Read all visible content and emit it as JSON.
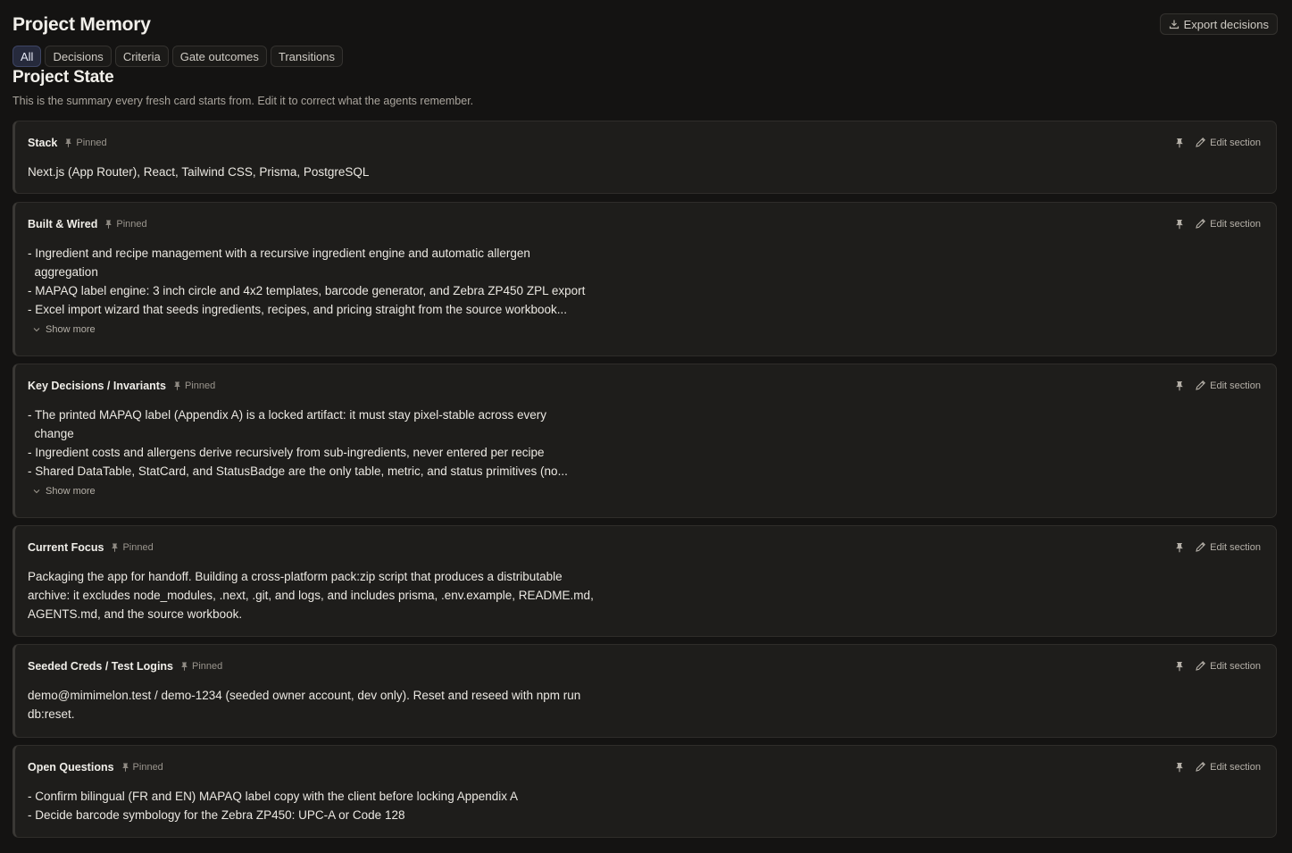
{
  "page": {
    "title": "Project Memory",
    "export_label": "Export decisions",
    "heading": "Project State",
    "subtitle": "This is the summary every fresh card starts from. Edit it to correct what the agents remember."
  },
  "tabs": [
    {
      "label": "All",
      "active": true
    },
    {
      "label": "Decisions"
    },
    {
      "label": "Criteria"
    },
    {
      "label": "Gate outcomes"
    },
    {
      "label": "Transitions"
    }
  ],
  "labels": {
    "pinned": "Pinned",
    "edit": "Edit section",
    "show_more": "Show more"
  },
  "sections": [
    {
      "title": "Stack",
      "lines": [
        "Next.js (App Router), React, Tailwind CSS, Prisma, PostgreSQL"
      ]
    },
    {
      "title": "Built & Wired",
      "lines": [
        "- Ingredient and recipe management with a recursive ingredient engine and automatic allergen",
        "  aggregation",
        "- MAPAQ label engine: 3 inch circle and 4x2 templates, barcode generator, and Zebra ZP450 ZPL export",
        "- Excel import wizard that seeds ingredients, recipes, and pricing straight from the source workbook..."
      ]
    },
    {
      "title": "Key Decisions / Invariants",
      "lines": [
        "- The printed MAPAQ label (Appendix A) is a locked artifact: it must stay pixel-stable across every",
        "  change",
        "- Ingredient costs and allergens derive recursively from sub-ingredients, never entered per recipe",
        "- Shared DataTable, StatCard, and StatusBadge are the only table, metric, and status primitives (no..."
      ]
    },
    {
      "title": "Current Focus",
      "lines": [
        "Packaging the app for handoff. Building a cross-platform pack:zip script that produces a distributable",
        "archive: it excludes node_modules, .next, .git, and logs, and includes prisma, .env.example, README.md,",
        "AGENTS.md, and the source workbook."
      ]
    },
    {
      "title": "Seeded Creds / Test Logins",
      "lines": [
        "demo@mimimelon.test / demo-1234 (seeded owner account, dev only). Reset and reseed with npm run",
        "db:reset."
      ]
    },
    {
      "title": "Open Questions",
      "lines": [
        "- Confirm bilingual (FR and EN) MAPAQ label copy with the client before locking Appendix A",
        "- Decide barcode symbology for the Zebra ZP450: UPC-A or Code 128"
      ]
    }
  ]
}
